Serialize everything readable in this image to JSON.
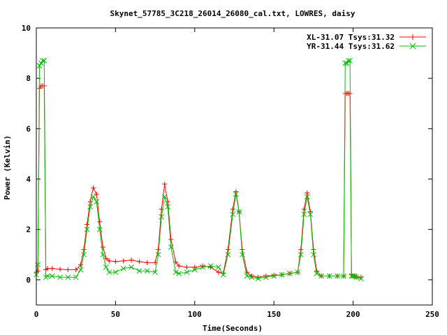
{
  "chart_data": {
    "type": "line",
    "title": "Skynet_57785_3C218_26014_26080_cal.txt, LOWRES, daisy",
    "xlabel": "Time(Seconds)",
    "ylabel": "Power (Kelvin)",
    "xlim": [
      0,
      250
    ],
    "ylim": [
      -1,
      10
    ],
    "xticks": [
      0,
      50,
      100,
      150,
      200,
      250
    ],
    "yticks": [
      0,
      2,
      4,
      6,
      8,
      10
    ],
    "grid": false,
    "legend_position": "top-right",
    "series": [
      {
        "name": "XL-31.07 Tsys:31.32",
        "color": "#ff0000",
        "marker": "plus",
        "x": [
          0,
          1,
          2,
          3,
          4,
          5,
          6,
          7,
          10,
          15,
          20,
          25,
          28,
          30,
          32,
          34,
          36,
          38,
          40,
          42,
          44,
          46,
          50,
          55,
          60,
          65,
          70,
          75,
          77,
          79,
          81,
          83,
          85,
          88,
          90,
          95,
          100,
          105,
          110,
          115,
          118,
          121,
          124,
          126,
          128,
          130,
          133,
          136,
          140,
          145,
          150,
          155,
          160,
          165,
          167,
          169,
          171,
          173,
          175,
          177,
          180,
          185,
          190,
          194,
          195,
          196,
          197,
          198,
          199,
          200,
          201,
          202,
          205
        ],
        "y": [
          0.3,
          0.35,
          7.6,
          7.7,
          7.7,
          7.7,
          0.4,
          0.45,
          0.45,
          0.42,
          0.4,
          0.4,
          0.6,
          1.2,
          2.2,
          3.1,
          3.65,
          3.4,
          2.3,
          1.3,
          0.85,
          0.75,
          0.72,
          0.75,
          0.78,
          0.72,
          0.68,
          0.68,
          1.2,
          2.8,
          3.8,
          3.1,
          1.6,
          0.7,
          0.55,
          0.5,
          0.5,
          0.55,
          0.5,
          0.3,
          0.25,
          1.2,
          2.8,
          3.5,
          2.7,
          1.2,
          0.3,
          0.15,
          0.1,
          0.15,
          0.18,
          0.2,
          0.25,
          0.3,
          1.2,
          2.8,
          3.45,
          2.7,
          1.2,
          0.35,
          0.15,
          0.15,
          0.15,
          0.15,
          7.4,
          7.4,
          7.4,
          7.4,
          0.2,
          0.15,
          0.15,
          0.1,
          0.1
        ]
      },
      {
        "name": "YR-31.44 Tsys:31.62",
        "color": "#00c000",
        "marker": "cross",
        "x": [
          0,
          1,
          2,
          3,
          4,
          5,
          6,
          7,
          10,
          15,
          20,
          25,
          28,
          30,
          32,
          34,
          36,
          38,
          40,
          42,
          44,
          46,
          50,
          55,
          60,
          65,
          70,
          75,
          77,
          79,
          81,
          83,
          85,
          88,
          90,
          95,
          100,
          105,
          110,
          115,
          118,
          121,
          124,
          126,
          128,
          130,
          133,
          136,
          140,
          145,
          150,
          155,
          160,
          165,
          167,
          169,
          171,
          173,
          175,
          177,
          180,
          185,
          190,
          194,
          195,
          196,
          197,
          198,
          199,
          200,
          201,
          202,
          205
        ],
        "y": [
          0.2,
          0.6,
          8.5,
          8.6,
          8.7,
          8.7,
          0.1,
          0.15,
          0.15,
          0.1,
          0.1,
          0.1,
          0.4,
          1.0,
          2.0,
          2.9,
          3.3,
          3.1,
          2.0,
          1.0,
          0.5,
          0.3,
          0.3,
          0.45,
          0.5,
          0.35,
          0.35,
          0.3,
          1.0,
          2.5,
          3.3,
          2.9,
          1.3,
          0.3,
          0.25,
          0.3,
          0.4,
          0.5,
          0.55,
          0.5,
          0.2,
          1.0,
          2.6,
          3.4,
          2.7,
          1.0,
          0.15,
          0.1,
          0.05,
          0.1,
          0.15,
          0.2,
          0.25,
          0.3,
          1.0,
          2.6,
          3.3,
          2.6,
          1.0,
          0.25,
          0.15,
          0.15,
          0.15,
          0.15,
          8.6,
          8.6,
          8.7,
          8.7,
          0.15,
          0.15,
          0.15,
          0.1,
          0.05
        ]
      }
    ]
  }
}
